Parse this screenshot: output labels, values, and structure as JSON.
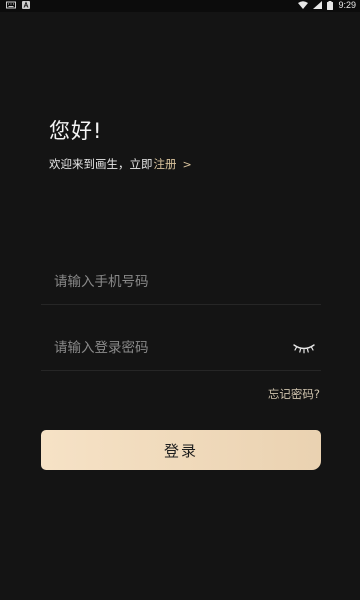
{
  "status_bar": {
    "time": "9:29",
    "icons": [
      "keyboard-icon",
      "notification-a-icon",
      "wifi-icon",
      "signal-icon",
      "battery-icon"
    ]
  },
  "header": {
    "greeting": "您好!",
    "welcome_text": "欢迎来到画生，立即",
    "register_label": "注册",
    "register_chevron": ">"
  },
  "form": {
    "phone_placeholder": "请输入手机号码",
    "phone_value": "",
    "password_placeholder": "请输入登录密码",
    "password_value": "",
    "password_visibility_icon": "eye-closed-icon",
    "forgot_label": "忘记密码?",
    "login_label": "登录"
  },
  "colors": {
    "background": "#141414",
    "accent": "#d8c29c",
    "button_gradient_start": "#f6e2c6",
    "button_gradient_end": "#ead2b1"
  }
}
